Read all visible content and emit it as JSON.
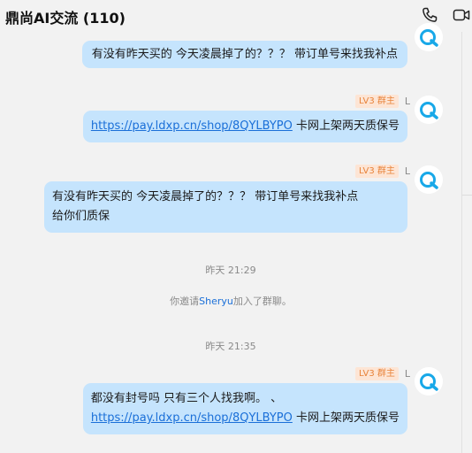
{
  "header": {
    "title": "鼎尚AI交流 (110)",
    "call_icon": "phone-icon",
    "video_icon": "video-icon"
  },
  "messages": [
    {
      "text": "有没有昨天买的  今天凌晨掉了的？？？   带订单号来找我补点"
    },
    {
      "badge": "LV3 群主",
      "sender": "L",
      "link": "https://pay.ldxp.cn/shop/8QYLBYPO",
      "text": "  卡网上架两天质保号"
    },
    {
      "badge": "LV3 群主",
      "sender": "L",
      "line1": "有没有昨天买的  今天凌晨掉了的？？？   带订单号来找我补点",
      "line2": "给你们质保"
    },
    {
      "badge": "LV3 群主",
      "sender": "L",
      "line1": "都没有封号吗  只有三个人找我啊。 、",
      "link": "https://pay.ldxp.cn/shop/8QYLBYPO",
      "text": "  卡网上架两天质保号"
    }
  ],
  "system": {
    "time1": "昨天 21:29",
    "invite_prefix": "你邀请",
    "invite_name": "Sheryu",
    "invite_suffix": "加入了群聊。",
    "time2": "昨天 21:35"
  },
  "colors": {
    "bubble": "#c5e4fd",
    "link": "#1a6fd8",
    "badge_bg": "#fde5d5",
    "badge_text": "#e8833a",
    "avatar_accent": "#18a8e8"
  }
}
